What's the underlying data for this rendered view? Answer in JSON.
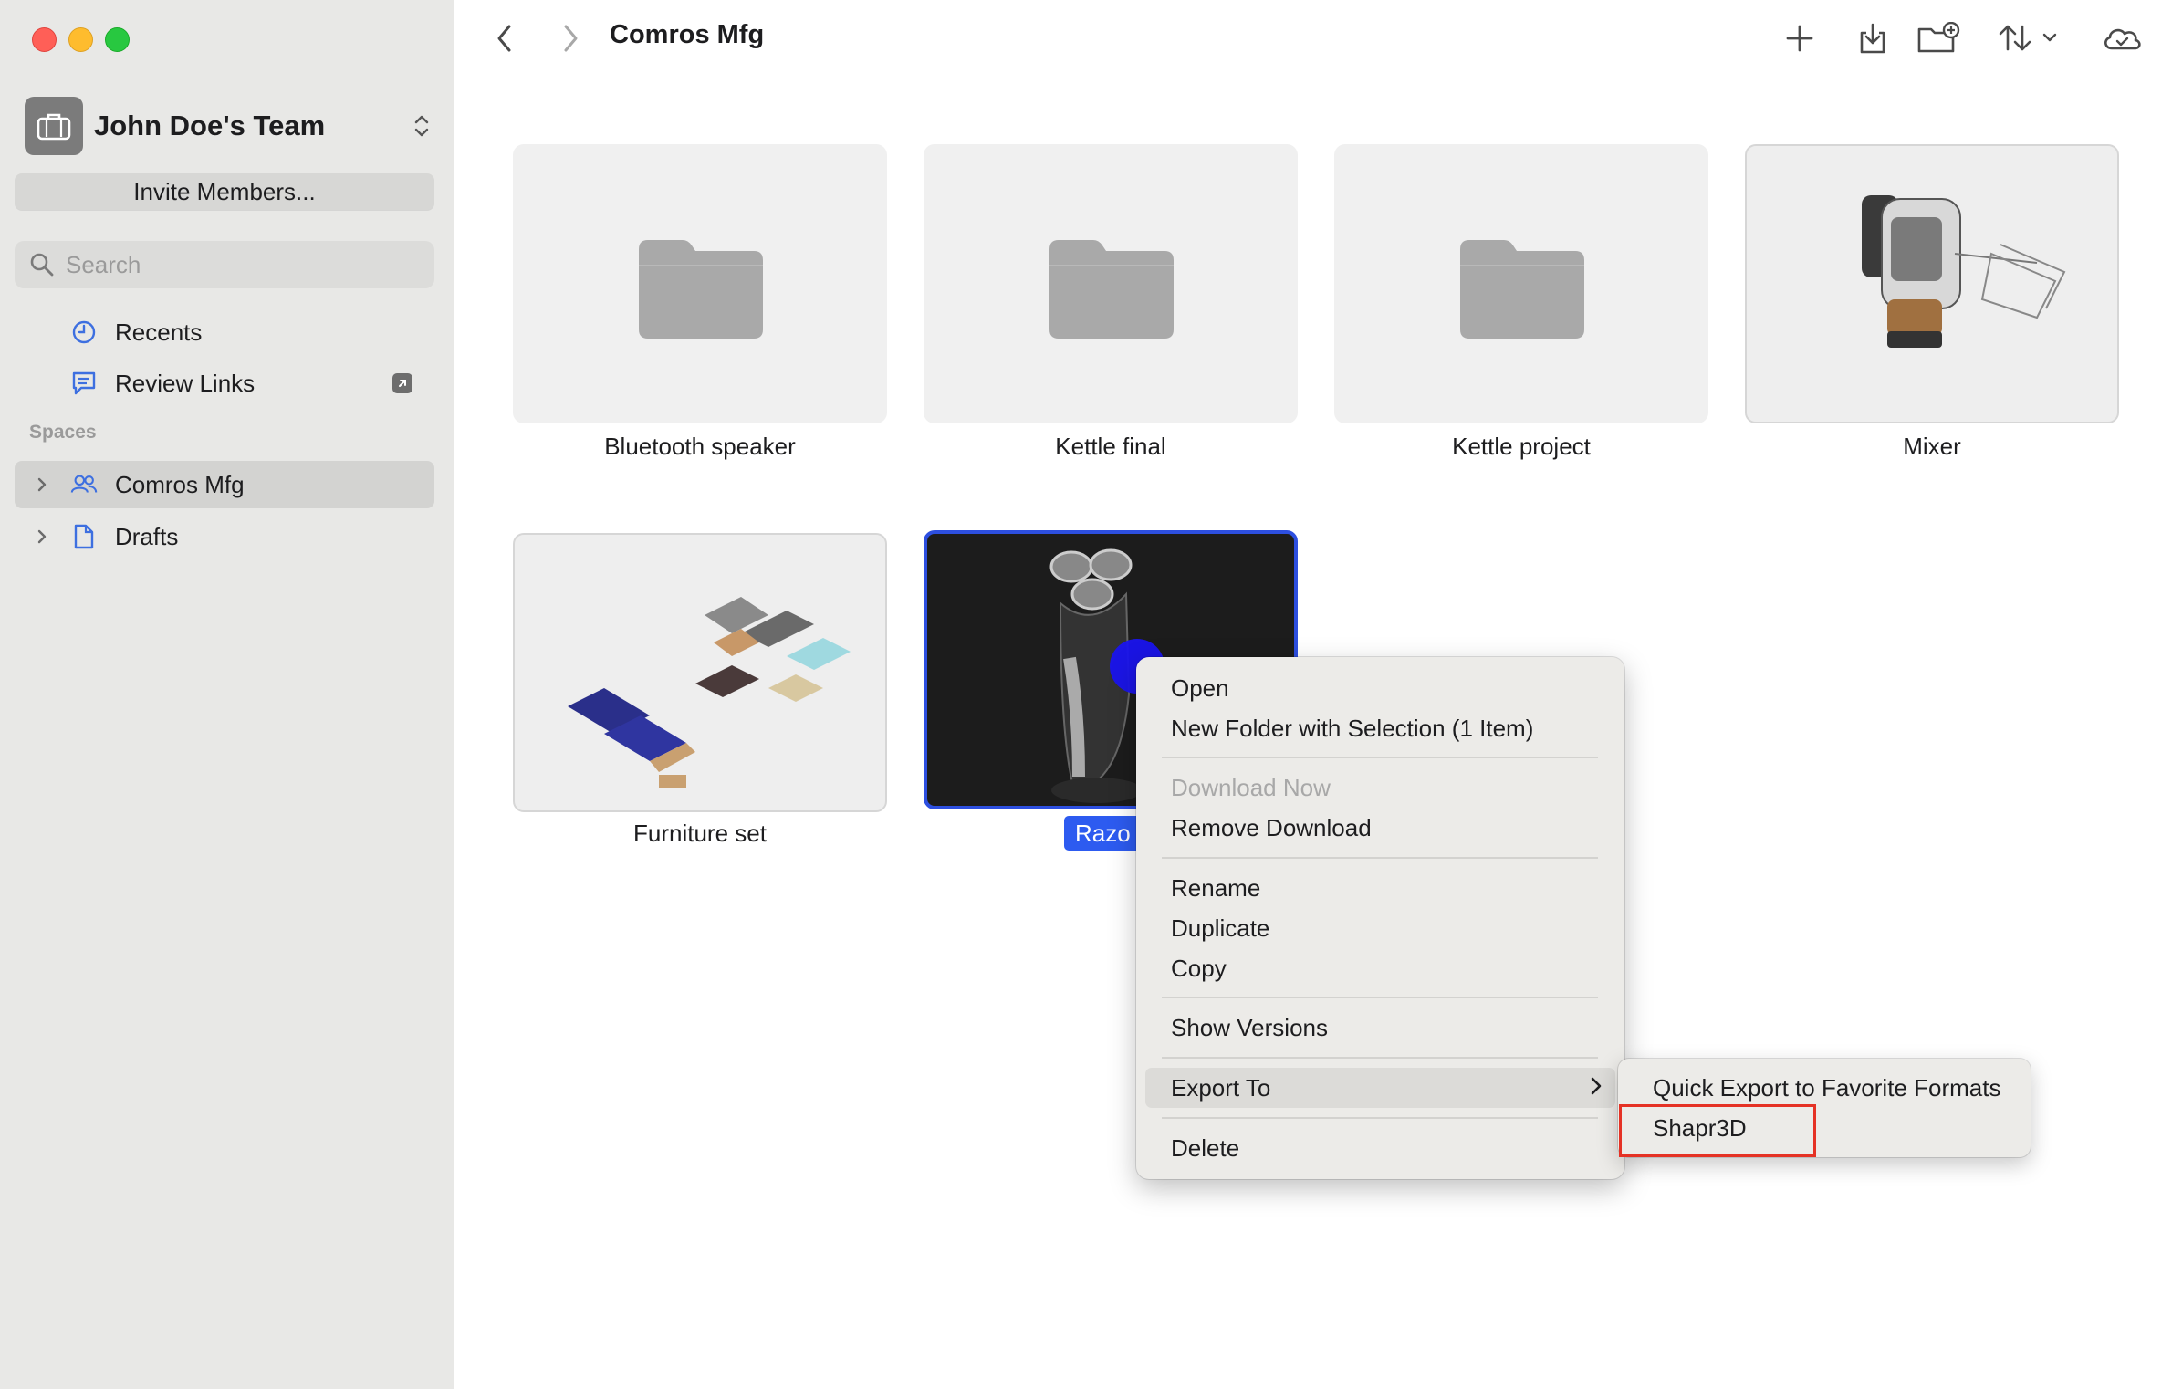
{
  "window": {
    "title": "Comros Mfg"
  },
  "sidebar": {
    "team_name": "John Doe's Team",
    "invite_label": "Invite Members...",
    "search_placeholder": "Search",
    "items": [
      {
        "label": "Recents",
        "icon": "clock-icon"
      },
      {
        "label": "Review Links",
        "icon": "comment-icon",
        "badge_icon": "external-link-icon"
      }
    ],
    "spaces_label": "Spaces",
    "spaces": [
      {
        "label": "Comros Mfg",
        "icon": "people-icon",
        "selected": true
      },
      {
        "label": "Drafts",
        "icon": "document-icon",
        "selected": false
      }
    ]
  },
  "toolbar": {
    "title": "Comros Mfg",
    "icons": [
      "back-icon",
      "forward-icon",
      "plus-icon",
      "import-icon",
      "new-folder-icon",
      "sort-icon",
      "cloud-icon"
    ]
  },
  "files": [
    {
      "name": "Bluetooth speaker",
      "kind": "folder"
    },
    {
      "name": "Kettle final",
      "kind": "folder"
    },
    {
      "name": "Kettle project",
      "kind": "folder"
    },
    {
      "name": "Mixer",
      "kind": "model"
    },
    {
      "name": "Furniture set",
      "kind": "model"
    },
    {
      "name": "Razor",
      "kind": "model",
      "selected": true,
      "visible_label": "Razo"
    }
  ],
  "context_menu": {
    "items": [
      {
        "label": "Open"
      },
      {
        "label": "New Folder with Selection (1 Item)"
      },
      {
        "label": "Download Now",
        "disabled": true
      },
      {
        "label": "Remove Download"
      },
      {
        "label": "Rename"
      },
      {
        "label": "Duplicate"
      },
      {
        "label": "Copy"
      },
      {
        "label": "Show Versions"
      },
      {
        "label": "Export To",
        "has_submenu": true,
        "highlighted": true
      },
      {
        "label": "Delete"
      }
    ]
  },
  "submenu": {
    "items": [
      {
        "label": "Quick Export to Favorite Formats"
      },
      {
        "label": "Shapr3D",
        "annotated": true
      }
    ]
  },
  "colors": {
    "accent": "#2d5bf0",
    "annotation": "#e53225",
    "sidebar_bg": "#e8e8e6",
    "icon_blue": "#3d6fe0"
  }
}
